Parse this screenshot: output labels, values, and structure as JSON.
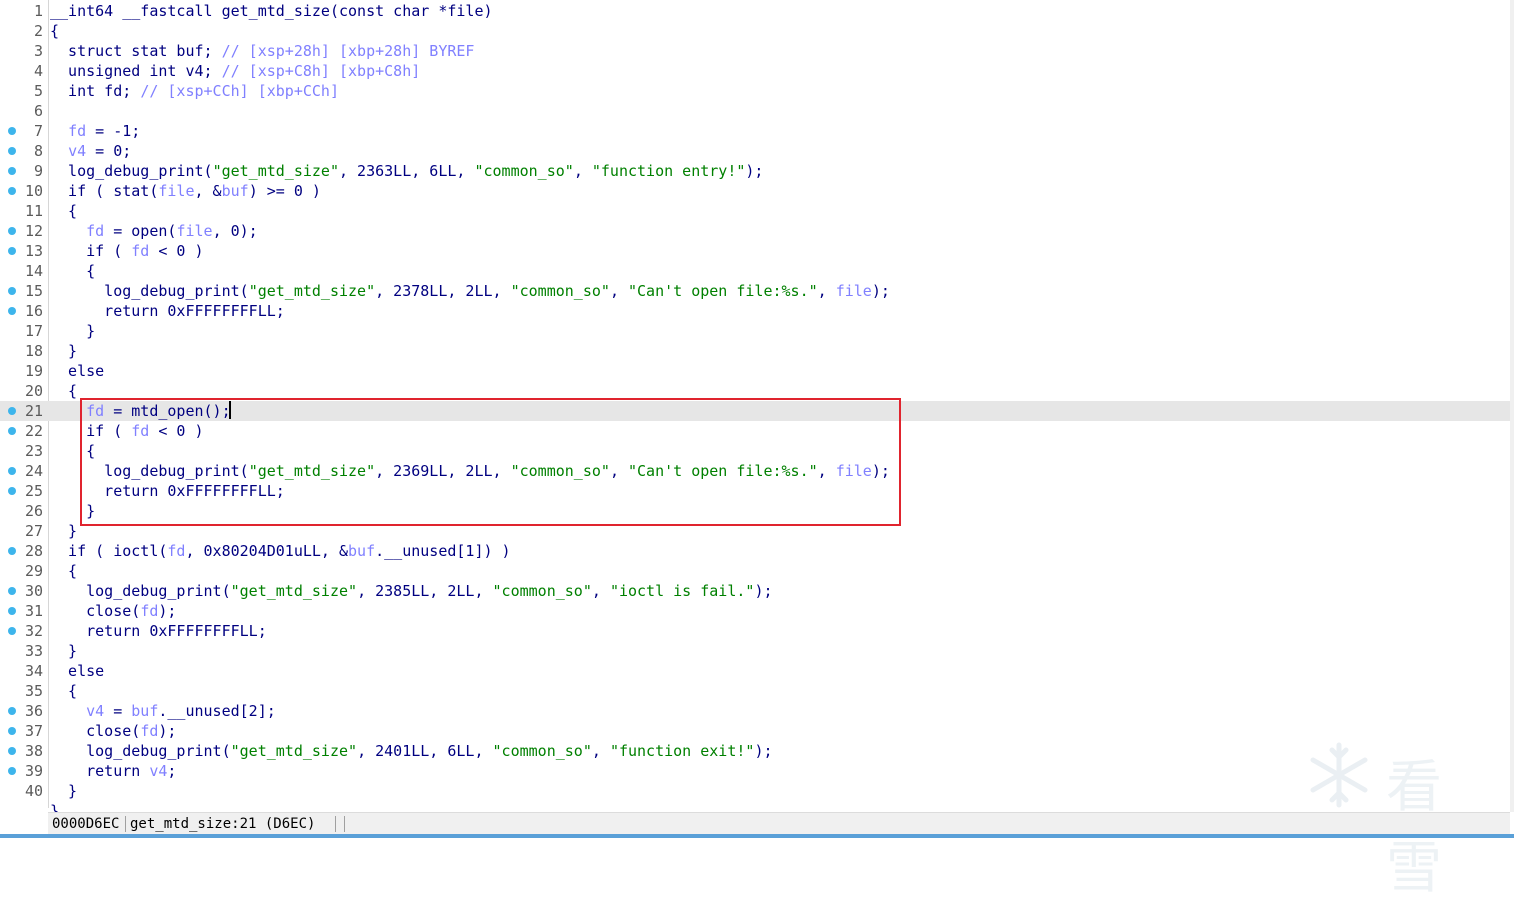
{
  "lines": [
    {
      "n": "1",
      "bp": false,
      "tokens": [
        [
          "__int64 __fastcall get_mtd_size(const char *file)",
          "plain"
        ]
      ]
    },
    {
      "n": "2",
      "bp": false,
      "tokens": [
        [
          "{",
          "plain"
        ]
      ]
    },
    {
      "n": "3",
      "bp": false,
      "tokens": [
        [
          "  struct stat buf; ",
          "plain"
        ],
        [
          "// [xsp+28h] [xbp+28h] BYREF",
          "cmt"
        ]
      ]
    },
    {
      "n": "4",
      "bp": false,
      "tokens": [
        [
          "  unsigned int v4; ",
          "plain"
        ],
        [
          "// [xsp+C8h] [xbp+C8h]",
          "cmt"
        ]
      ]
    },
    {
      "n": "5",
      "bp": false,
      "tokens": [
        [
          "  int fd; ",
          "plain"
        ],
        [
          "// [xsp+CCh] [xbp+CCh]",
          "cmt"
        ]
      ]
    },
    {
      "n": "6",
      "bp": false,
      "tokens": []
    },
    {
      "n": "7",
      "bp": true,
      "tokens": [
        [
          "  ",
          "plain"
        ],
        [
          "fd",
          "var"
        ],
        [
          " = -1;",
          "plain"
        ]
      ]
    },
    {
      "n": "8",
      "bp": true,
      "tokens": [
        [
          "  ",
          "plain"
        ],
        [
          "v4",
          "var"
        ],
        [
          " = 0;",
          "plain"
        ]
      ]
    },
    {
      "n": "9",
      "bp": true,
      "tokens": [
        [
          "  log_debug_print(",
          "plain"
        ],
        [
          "\"get_mtd_size\"",
          "str"
        ],
        [
          ", 2363LL, 6LL, ",
          "plain"
        ],
        [
          "\"common_so\"",
          "str"
        ],
        [
          ", ",
          "plain"
        ],
        [
          "\"function entry!\"",
          "str"
        ],
        [
          ");",
          "plain"
        ]
      ]
    },
    {
      "n": "10",
      "bp": true,
      "tokens": [
        [
          "  if ( stat(",
          "plain"
        ],
        [
          "file",
          "var"
        ],
        [
          ", &",
          "plain"
        ],
        [
          "buf",
          "var"
        ],
        [
          ") >= 0 )",
          "plain"
        ]
      ]
    },
    {
      "n": "11",
      "bp": false,
      "tokens": [
        [
          "  {",
          "plain"
        ]
      ]
    },
    {
      "n": "12",
      "bp": true,
      "tokens": [
        [
          "    ",
          "plain"
        ],
        [
          "fd",
          "var"
        ],
        [
          " = open(",
          "plain"
        ],
        [
          "file",
          "var"
        ],
        [
          ", 0);",
          "plain"
        ]
      ]
    },
    {
      "n": "13",
      "bp": true,
      "tokens": [
        [
          "    if ( ",
          "plain"
        ],
        [
          "fd",
          "var"
        ],
        [
          " < 0 )",
          "plain"
        ]
      ]
    },
    {
      "n": "14",
      "bp": false,
      "tokens": [
        [
          "    {",
          "plain"
        ]
      ]
    },
    {
      "n": "15",
      "bp": true,
      "tokens": [
        [
          "      log_debug_print(",
          "plain"
        ],
        [
          "\"get_mtd_size\"",
          "str"
        ],
        [
          ", 2378LL, 2LL, ",
          "plain"
        ],
        [
          "\"common_so\"",
          "str"
        ],
        [
          ", ",
          "plain"
        ],
        [
          "\"Can't open file:%s.\"",
          "str"
        ],
        [
          ", ",
          "plain"
        ],
        [
          "file",
          "var"
        ],
        [
          ");",
          "plain"
        ]
      ]
    },
    {
      "n": "16",
      "bp": true,
      "tokens": [
        [
          "      return 0xFFFFFFFFLL;",
          "plain"
        ]
      ]
    },
    {
      "n": "17",
      "bp": false,
      "tokens": [
        [
          "    }",
          "plain"
        ]
      ]
    },
    {
      "n": "18",
      "bp": false,
      "tokens": [
        [
          "  }",
          "plain"
        ]
      ]
    },
    {
      "n": "19",
      "bp": false,
      "tokens": [
        [
          "  else",
          "plain"
        ]
      ]
    },
    {
      "n": "20",
      "bp": false,
      "tokens": [
        [
          "  {",
          "plain"
        ]
      ]
    },
    {
      "n": "21",
      "bp": true,
      "hl": true,
      "tokens": [
        [
          "    ",
          "plain"
        ],
        [
          "fd",
          "var"
        ],
        [
          " = mtd_open();",
          "plain"
        ]
      ]
    },
    {
      "n": "22",
      "bp": true,
      "tokens": [
        [
          "    if ( ",
          "plain"
        ],
        [
          "fd",
          "var"
        ],
        [
          " < 0 )",
          "plain"
        ]
      ]
    },
    {
      "n": "23",
      "bp": false,
      "tokens": [
        [
          "    {",
          "plain"
        ]
      ]
    },
    {
      "n": "24",
      "bp": true,
      "tokens": [
        [
          "      log_debug_print(",
          "plain"
        ],
        [
          "\"get_mtd_size\"",
          "str"
        ],
        [
          ", 2369LL, 2LL, ",
          "plain"
        ],
        [
          "\"common_so\"",
          "str"
        ],
        [
          ", ",
          "plain"
        ],
        [
          "\"Can't open file:%s.\"",
          "str"
        ],
        [
          ", ",
          "plain"
        ],
        [
          "file",
          "var"
        ],
        [
          ");",
          "plain"
        ]
      ]
    },
    {
      "n": "25",
      "bp": true,
      "tokens": [
        [
          "      return 0xFFFFFFFFLL;",
          "plain"
        ]
      ]
    },
    {
      "n": "26",
      "bp": false,
      "tokens": [
        [
          "    }",
          "plain"
        ]
      ]
    },
    {
      "n": "27",
      "bp": false,
      "tokens": [
        [
          "  }",
          "plain"
        ]
      ]
    },
    {
      "n": "28",
      "bp": true,
      "tokens": [
        [
          "  if ( ioctl(",
          "plain"
        ],
        [
          "fd",
          "var"
        ],
        [
          ", 0x80204D01uLL, &",
          "plain"
        ],
        [
          "buf",
          "var"
        ],
        [
          ".__unused[1]) )",
          "plain"
        ]
      ]
    },
    {
      "n": "29",
      "bp": false,
      "tokens": [
        [
          "  {",
          "plain"
        ]
      ]
    },
    {
      "n": "30",
      "bp": true,
      "tokens": [
        [
          "    log_debug_print(",
          "plain"
        ],
        [
          "\"get_mtd_size\"",
          "str"
        ],
        [
          ", 2385LL, 2LL, ",
          "plain"
        ],
        [
          "\"common_so\"",
          "str"
        ],
        [
          ", ",
          "plain"
        ],
        [
          "\"ioctl is fail.\"",
          "str"
        ],
        [
          ");",
          "plain"
        ]
      ]
    },
    {
      "n": "31",
      "bp": true,
      "tokens": [
        [
          "    close(",
          "plain"
        ],
        [
          "fd",
          "var"
        ],
        [
          ");",
          "plain"
        ]
      ]
    },
    {
      "n": "32",
      "bp": true,
      "tokens": [
        [
          "    return 0xFFFFFFFFLL;",
          "plain"
        ]
      ]
    },
    {
      "n": "33",
      "bp": false,
      "tokens": [
        [
          "  }",
          "plain"
        ]
      ]
    },
    {
      "n": "34",
      "bp": false,
      "tokens": [
        [
          "  else",
          "plain"
        ]
      ]
    },
    {
      "n": "35",
      "bp": false,
      "tokens": [
        [
          "  {",
          "plain"
        ]
      ]
    },
    {
      "n": "36",
      "bp": true,
      "tokens": [
        [
          "    ",
          "plain"
        ],
        [
          "v4",
          "var"
        ],
        [
          " = ",
          "plain"
        ],
        [
          "buf",
          "var"
        ],
        [
          ".__unused[2];",
          "plain"
        ]
      ]
    },
    {
      "n": "37",
      "bp": true,
      "tokens": [
        [
          "    close(",
          "plain"
        ],
        [
          "fd",
          "var"
        ],
        [
          ");",
          "plain"
        ]
      ]
    },
    {
      "n": "38",
      "bp": true,
      "tokens": [
        [
          "    log_debug_print(",
          "plain"
        ],
        [
          "\"get_mtd_size\"",
          "str"
        ],
        [
          ", 2401LL, 6LL, ",
          "plain"
        ],
        [
          "\"common_so\"",
          "str"
        ],
        [
          ", ",
          "plain"
        ],
        [
          "\"function exit!\"",
          "str"
        ],
        [
          ");",
          "plain"
        ]
      ]
    },
    {
      "n": "39",
      "bp": true,
      "tokens": [
        [
          "    return ",
          "plain"
        ],
        [
          "v4",
          "var"
        ],
        [
          ";",
          "plain"
        ]
      ]
    },
    {
      "n": "40",
      "bp": false,
      "tokens": [
        [
          "  }",
          "plain"
        ]
      ]
    },
    {
      "n": "",
      "bp": false,
      "tokens": [
        [
          "}",
          "plain"
        ]
      ]
    }
  ],
  "statusbar": {
    "address": "0000D6EC",
    "location": "get_mtd_size:21 (D6EC)"
  },
  "watermark": {
    "text": "看雪",
    "icon": "snowflake-icon"
  },
  "colors": {
    "breakpoint": "#3db5ec",
    "highlight_box": "#e0242e",
    "string": "#008000",
    "variable": "#8080ff",
    "keyword": "#000080"
  }
}
